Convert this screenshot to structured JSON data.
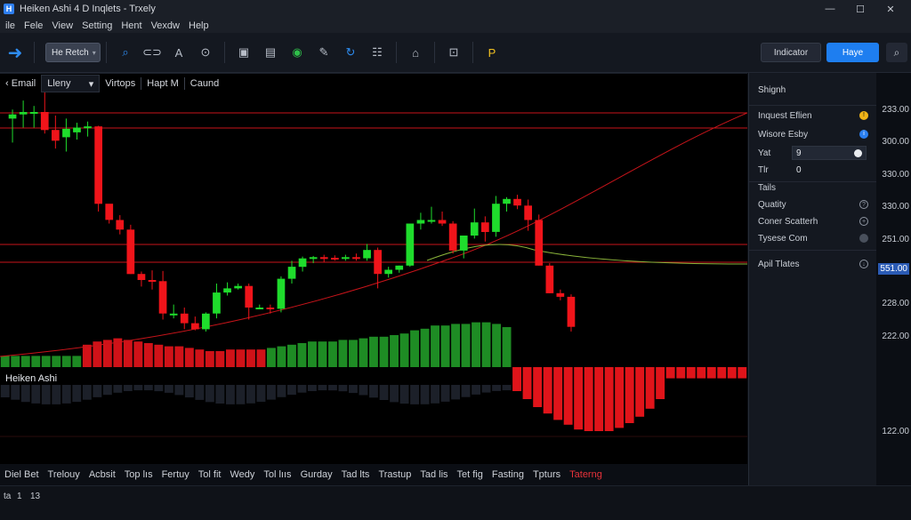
{
  "window": {
    "title": "Heiken Ashi 4 D Inqlets - Trxely",
    "controls": [
      "—",
      "☐",
      "✕"
    ]
  },
  "menu": [
    "ile",
    "Fele",
    "View",
    "Setting",
    "Hent",
    "Vexdw",
    "Help"
  ],
  "toolbar": {
    "symbol_select": "He Retch",
    "indicator_label": "Indicator",
    "primary_label": "Haye",
    "icons": [
      "arrow-right-icon",
      "search-icon",
      "chart-type-icon",
      "text-icon",
      "zoom-icon",
      "layout-icon",
      "clipboard-icon",
      "alert-icon",
      "drawing-icon",
      "refresh-icon",
      "grid-icon",
      "lock-icon",
      "template-icon",
      "strategy-icon"
    ]
  },
  "chart_tabs": {
    "first": "Email",
    "dropdown": "Lleny",
    "tabs": [
      "Virtops",
      "Hapt M",
      "Caund"
    ]
  },
  "indicator_label": "Heiken Ashi",
  "side_panel": {
    "title": "Shignh",
    "rows": [
      {
        "label": "Inquest Eflien",
        "icon": "warning-icon"
      },
      {
        "label": "Wisore Esby",
        "icon": "info-icon"
      }
    ],
    "inputs": [
      {
        "label": "Yat",
        "value": "9"
      },
      {
        "label": "Tlr",
        "value": "0"
      }
    ],
    "section": "Tails",
    "options": [
      {
        "label": "Quatity",
        "icon": "help-icon"
      },
      {
        "label": "Coner Scatterh",
        "icon": "globe-icon"
      },
      {
        "label": "Tysese Com",
        "icon": "dot-icon"
      }
    ],
    "footer": {
      "label": "Apil Tlates",
      "icon": "download-icon"
    }
  },
  "price_axis": [
    "233.00",
    "300.00",
    "330.00",
    "330.00",
    "251.00",
    "551.00",
    "228.00",
    "222.00",
    "122.00"
  ],
  "date_axis": [
    "Diel Bet",
    "Trelouy",
    "Acbsit",
    "Top lıs",
    "Fertuy",
    "Tol fit",
    "Wedy",
    "Tol lııs",
    "Gurday",
    "Tad lts",
    "Trastup",
    "Tad lis",
    "Tet fig",
    "Fasting",
    "Tpturs",
    "Taterng"
  ],
  "status": {
    "left": "ta",
    "mid": "1",
    "right": "13"
  },
  "colors": {
    "up": "#1fdc2c",
    "down": "#f0141a",
    "accent": "#1e7ef0",
    "price_highlight": "#2b5bb5"
  },
  "chart_data": {
    "type": "candlestick",
    "title": "",
    "candles": [
      {
        "o": 255,
        "h": 270,
        "l": 215,
        "c": 262
      },
      {
        "o": 262,
        "h": 285,
        "l": 240,
        "c": 266
      },
      {
        "o": 266,
        "h": 276,
        "l": 240,
        "c": 266
      },
      {
        "o": 266,
        "h": 300,
        "l": 230,
        "c": 236
      },
      {
        "o": 236,
        "h": 260,
        "l": 205,
        "c": 218
      },
      {
        "o": 224,
        "h": 255,
        "l": 200,
        "c": 238
      },
      {
        "o": 232,
        "h": 248,
        "l": 220,
        "c": 240
      },
      {
        "o": 240,
        "h": 250,
        "l": 225,
        "c": 242
      },
      {
        "o": 242,
        "h": 243,
        "l": 100,
        "c": 113
      },
      {
        "o": 113,
        "h": 112,
        "l": 80,
        "c": 86
      },
      {
        "o": 86,
        "h": 94,
        "l": 62,
        "c": 70
      },
      {
        "o": 70,
        "h": 78,
        "l": -4,
        "c": -4
      },
      {
        "o": -4,
        "h": 0,
        "l": -25,
        "c": -14
      },
      {
        "o": -14,
        "h": 2,
        "l": -30,
        "c": -16
      },
      {
        "o": -16,
        "h": 1,
        "l": -80,
        "c": -70
      },
      {
        "o": -70,
        "h": -55,
        "l": -78,
        "c": -70
      },
      {
        "o": -70,
        "h": -60,
        "l": -96,
        "c": -86
      },
      {
        "o": -86,
        "h": -75,
        "l": -98,
        "c": -96
      },
      {
        "o": -96,
        "h": -68,
        "l": -100,
        "c": -70
      },
      {
        "o": -70,
        "h": -20,
        "l": -78,
        "c": -35
      },
      {
        "o": -35,
        "h": -18,
        "l": -40,
        "c": -28
      },
      {
        "o": -28,
        "h": -20,
        "l": -30,
        "c": -24
      },
      {
        "o": -24,
        "h": -20,
        "l": -80,
        "c": -60
      },
      {
        "o": -60,
        "h": -55,
        "l": -62,
        "c": -60
      },
      {
        "o": -60,
        "h": -55,
        "l": -70,
        "c": -62
      },
      {
        "o": -62,
        "h": -8,
        "l": -68,
        "c": -12
      },
      {
        "o": -12,
        "h": 18,
        "l": -20,
        "c": 8
      },
      {
        "o": 8,
        "h": 25,
        "l": 0,
        "c": 22
      },
      {
        "o": 22,
        "h": 26,
        "l": 14,
        "c": 24
      },
      {
        "o": 24,
        "h": 28,
        "l": 16,
        "c": 23
      },
      {
        "o": 23,
        "h": 27,
        "l": 18,
        "c": 22
      },
      {
        "o": 22,
        "h": 28,
        "l": 18,
        "c": 24
      },
      {
        "o": 24,
        "h": 30,
        "l": 18,
        "c": 22
      },
      {
        "o": 22,
        "h": 46,
        "l": 18,
        "c": 36
      },
      {
        "o": 36,
        "h": 40,
        "l": -28,
        "c": -4
      },
      {
        "o": -4,
        "h": 8,
        "l": -10,
        "c": 3
      },
      {
        "o": 3,
        "h": 10,
        "l": -2,
        "c": 10
      },
      {
        "o": 10,
        "h": 80,
        "l": 8,
        "c": 80
      },
      {
        "o": 80,
        "h": 98,
        "l": 70,
        "c": 86
      },
      {
        "o": 86,
        "h": 108,
        "l": 80,
        "c": 86
      },
      {
        "o": 86,
        "h": 100,
        "l": 76,
        "c": 80
      },
      {
        "o": 80,
        "h": 84,
        "l": 30,
        "c": 35
      },
      {
        "o": 35,
        "h": 60,
        "l": 22,
        "c": 60
      },
      {
        "o": 60,
        "h": 105,
        "l": 55,
        "c": 82
      },
      {
        "o": 82,
        "h": 92,
        "l": 50,
        "c": 66
      },
      {
        "o": 66,
        "h": 126,
        "l": 58,
        "c": 113
      },
      {
        "o": 113,
        "h": 124,
        "l": 100,
        "c": 121
      },
      {
        "o": 121,
        "h": 128,
        "l": 104,
        "c": 110
      },
      {
        "o": 110,
        "h": 120,
        "l": 68,
        "c": 86
      },
      {
        "o": 86,
        "h": 95,
        "l": 10,
        "c": 10
      },
      {
        "o": 10,
        "h": 14,
        "l": -36,
        "c": -36
      },
      {
        "o": -36,
        "h": -30,
        "l": -48,
        "c": -42
      },
      {
        "o": -42,
        "h": -38,
        "l": -100,
        "c": -92
      }
    ],
    "volume": [
      14,
      14,
      14,
      14,
      14,
      14,
      14,
      14,
      28,
      32,
      34,
      36,
      34,
      32,
      30,
      28,
      26,
      26,
      24,
      22,
      20,
      20,
      22,
      22,
      22,
      22,
      24,
      26,
      28,
      30,
      32,
      32,
      32,
      34,
      34,
      36,
      38,
      38,
      40,
      42,
      46,
      48,
      52,
      52,
      54,
      54,
      56,
      56,
      54,
      50,
      -30,
      -40,
      -50,
      -58,
      -66,
      -72,
      -78,
      -80,
      -80,
      -80,
      -76,
      -70,
      -62,
      -52,
      -40,
      -14,
      -14,
      -14,
      -14,
      -14,
      -14,
      -14,
      -14
    ],
    "volume_up_from": 26,
    "volume_down_until": 52
  }
}
